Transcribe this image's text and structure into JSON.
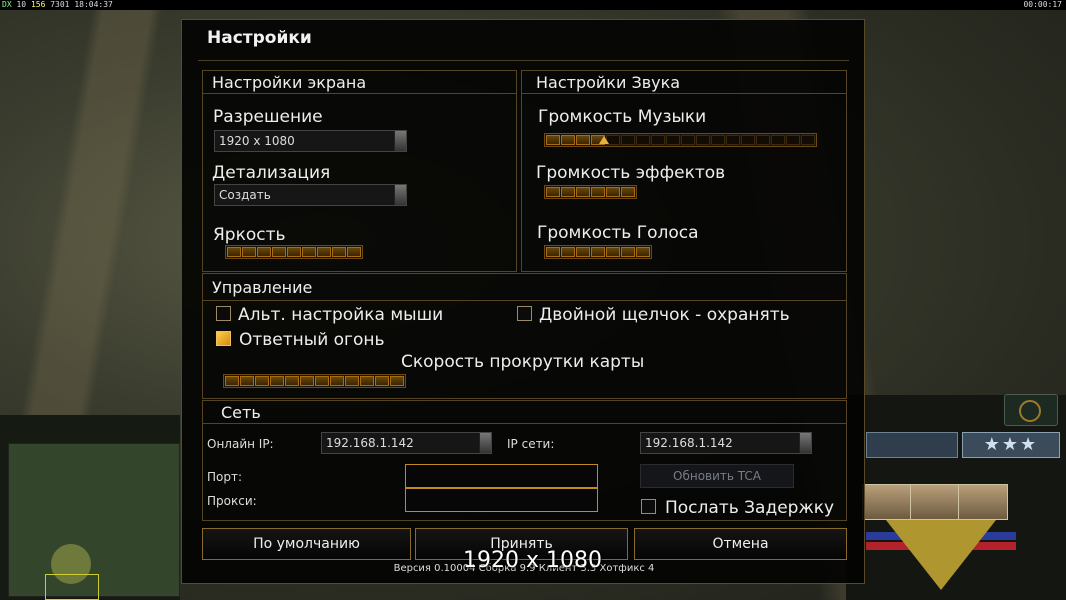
{
  "debug_bar": {
    "left_a": "DX",
    "left_b": "10",
    "left_c": "156",
    "left_d": "7301",
    "time_left": "18:04:37",
    "time_right": "00:00:17"
  },
  "hud": {
    "stars": "★★★"
  },
  "dialog": {
    "title": "Настройки",
    "screen_section": {
      "title": "Настройки экрана",
      "resolution_label": "Разрешение",
      "resolution_value": "1920 x 1080",
      "detail_label": "Детализация",
      "detail_value": "Создать",
      "brightness_label": "Яркость",
      "brightness_filled": 9,
      "brightness_total": 9
    },
    "sound_section": {
      "title": "Настройки Звука",
      "music_label": "Громкость Музыки",
      "music_filled": 4,
      "music_total": 18,
      "effects_label": "Громкость эффектов",
      "effects_filled": 6,
      "effects_total": 6,
      "voice_label": "Громкость Голоса",
      "voice_filled": 7,
      "voice_total": 7
    },
    "control_section": {
      "title": "Управление",
      "alt_mouse_label": "Альт. настройка мыши",
      "alt_mouse_checked": false,
      "double_click_label": "Двойной щелчок - охранять",
      "double_click_checked": false,
      "return_fire_label": "Ответный огонь",
      "return_fire_checked": true,
      "scroll_label": "Скорость прокрутки карты",
      "scroll_filled": 12,
      "scroll_total": 12
    },
    "network_section": {
      "title": "Сеть",
      "online_ip_label": "Онлайн IP:",
      "online_ip_value": "192.168.1.142",
      "net_ip_label": "IP сети:",
      "net_ip_value": "192.168.1.142",
      "port_label": "Порт:",
      "proxy_label": "Прокси:",
      "update_button": "Обновить TCA",
      "send_delay_label": "Послать Задержку",
      "send_delay_checked": false
    },
    "buttons": {
      "default": "По умолчанию",
      "accept": "Принять",
      "cancel": "Отмена"
    },
    "version_text": "Версия 0.10004 Сборка 9.9 Клиент 3.3 Хотфикс 4",
    "overlay_resolution": "1920 x 1080"
  },
  "colors": {
    "accent": "#c38a1e",
    "slider_fill": "#a66e14",
    "panel_border": "#544424"
  }
}
